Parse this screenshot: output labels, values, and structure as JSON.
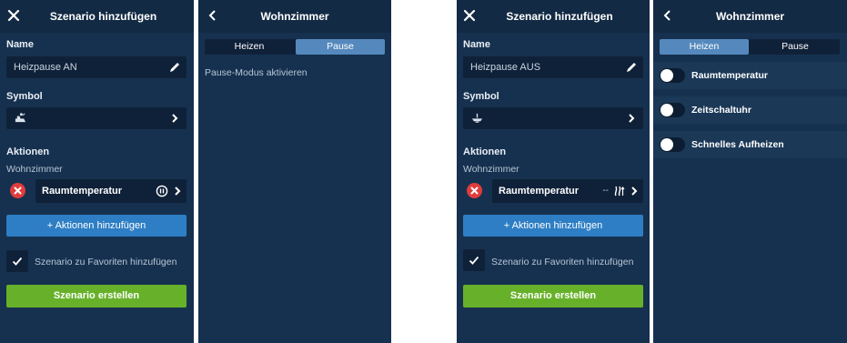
{
  "screens": {
    "scenario_on": {
      "title": "Szenario hinzufügen",
      "name_label": "Name",
      "name_value": "Heizpause AN",
      "symbol_label": "Symbol",
      "actions_label": "Aktionen",
      "room_label": "Wohnzimmer",
      "action_item": "Raumtemperatur",
      "add_actions_label": "+ Aktionen hinzufügen",
      "favorites_label": "Szenario zu Favoriten hinzufügen",
      "create_label": "Szenario erstellen"
    },
    "pause_mode": {
      "title": "Wohnzimmer",
      "tabs": [
        "Heizen",
        "Pause"
      ],
      "active_tab": "Pause",
      "hint": "Pause-Modus aktivieren"
    },
    "scenario_off": {
      "title": "Szenario hinzufügen",
      "name_label": "Name",
      "name_value": "Heizpause AUS",
      "symbol_label": "Symbol",
      "actions_label": "Aktionen",
      "room_label": "Wohnzimmer",
      "action_item": "Raumtemperatur",
      "action_value": "--",
      "add_actions_label": "+ Aktionen hinzufügen",
      "favorites_label": "Szenario zu Favoriten hinzufügen",
      "create_label": "Szenario erstellen"
    },
    "heating_mode": {
      "title": "Wohnzimmer",
      "tabs": [
        "Heizen",
        "Pause"
      ],
      "active_tab": "Heizen",
      "toggles": [
        "Raumtemperatur",
        "Zeitschaltuhr",
        "Schnelles Aufheizen"
      ]
    }
  },
  "colors": {
    "background": "#16314f",
    "header": "#132a44",
    "field": "#0f2138",
    "primary_blue": "#2d7ec4",
    "create_green": "#66b129",
    "remove_red": "#e03c3c",
    "segment_active": "#5589bd"
  },
  "icons": {
    "close": "close-icon",
    "back": "chevron-left-icon",
    "edit": "pencil-icon",
    "chevron": "chevron-right-icon",
    "pause": "pause-icon",
    "heat": "heat-icon",
    "check": "check-icon",
    "remove": "remove-icon"
  }
}
